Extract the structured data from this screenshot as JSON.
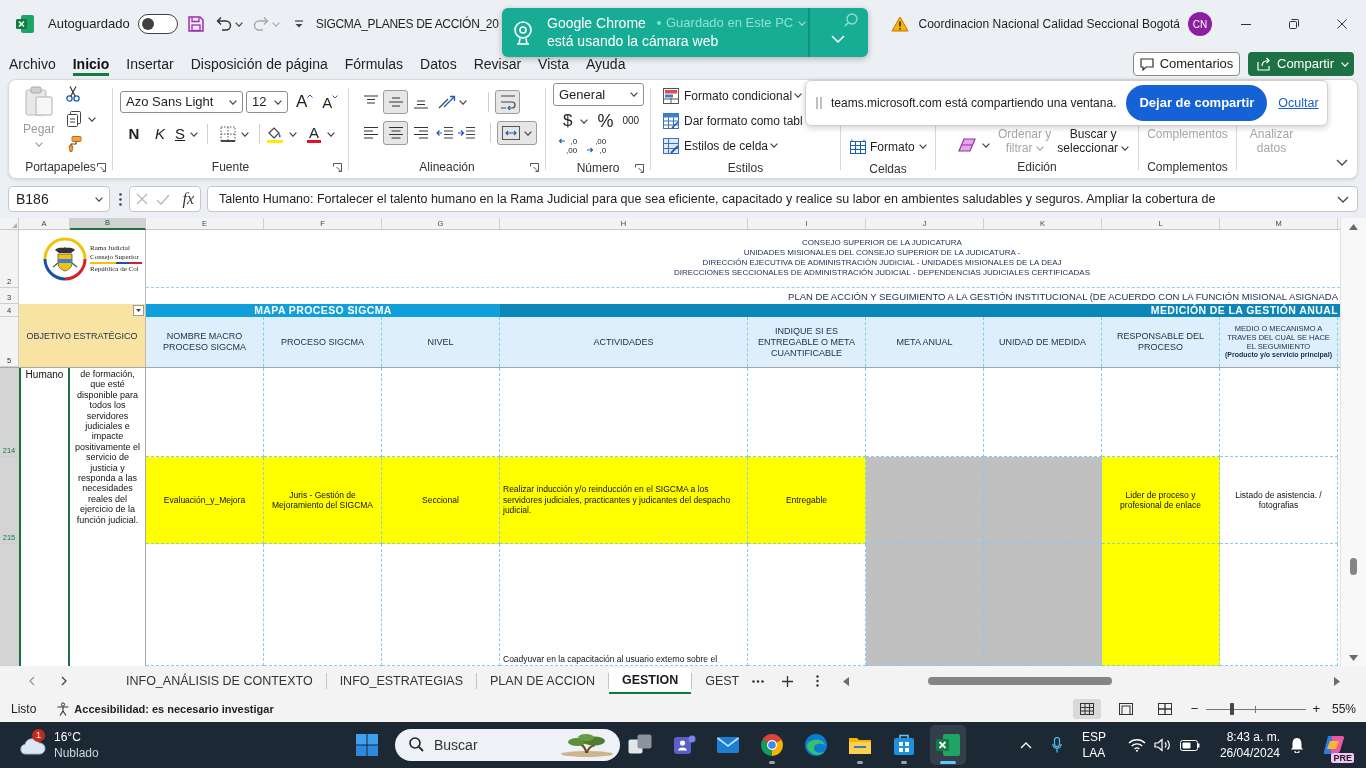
{
  "title_bar": {
    "autosave_label": "Autoguardado",
    "autosave_on": false,
    "file_name": "SIGCMA_PLANES DE ACCIÓN_20",
    "save_status": "Guardado en Este PC",
    "account_name": "Coordinacion Nacional Calidad Seccional Bogotá",
    "avatar_initials": "CN"
  },
  "camera_notification": {
    "app": "Google Chrome",
    "message": "está usando la cámara web"
  },
  "menu_tabs": [
    {
      "label": "Archivo",
      "selected": false
    },
    {
      "label": "Inicio",
      "selected": true
    },
    {
      "label": "Insertar",
      "selected": false
    },
    {
      "label": "Disposición de página",
      "selected": false
    },
    {
      "label": "Fórmulas",
      "selected": false
    },
    {
      "label": "Datos",
      "selected": false
    },
    {
      "label": "Revisar",
      "selected": false
    },
    {
      "label": "Vista",
      "selected": false
    },
    {
      "label": "Ayuda",
      "selected": false
    }
  ],
  "header_buttons": {
    "comments": "Comentarios",
    "share": "Compartir"
  },
  "ribbon": {
    "clipboard": {
      "paste": "Pegar",
      "paste_disabled": true,
      "label": "Portapapeles"
    },
    "font": {
      "font_name": "Azo Sans Light",
      "font_size": "12",
      "grow": "A",
      "shrink": "A",
      "bold": "N",
      "italic": "K",
      "underline": "S",
      "font_color": "A",
      "label": "Fuente"
    },
    "alignment": {
      "vertical": [
        {
          "kind": "top",
          "selected": false
        },
        {
          "kind": "middle",
          "selected": true
        },
        {
          "kind": "bottom",
          "selected": false
        }
      ],
      "horizontal": [
        {
          "kind": "left",
          "selected": false
        },
        {
          "kind": "center",
          "selected": true
        },
        {
          "kind": "right",
          "selected": false
        }
      ],
      "wrap_text": true,
      "merge": true,
      "label": "Alineación"
    },
    "number": {
      "format": "General",
      "currency": "$",
      "percent": "%",
      "thousands": "000",
      "decimals": [
        {
          "kind": "decrease",
          "upper": ",0",
          "lower": ",00"
        },
        {
          "kind": "increase",
          "upper": ",00",
          "lower": ",0"
        }
      ],
      "label": "Número"
    },
    "styles": {
      "items": [
        {
          "kind": "conditional",
          "label": "Formato condicional"
        },
        {
          "kind": "table",
          "label": "Dar formato como tabl"
        },
        {
          "kind": "cell_styles",
          "label": "Estilos de celda"
        }
      ],
      "label": "Estilos"
    },
    "cells": {
      "format": "Formato",
      "label": "Celdas"
    },
    "editing": {
      "buttons": [
        {
          "lines": [
            "Ordenar y",
            "filtrar"
          ],
          "disabled": true
        },
        {
          "lines": [
            "Buscar y",
            "seleccionar"
          ],
          "disabled": false
        }
      ],
      "label": "Edición"
    },
    "addins": {
      "item": "Complementos",
      "item_disabled": true,
      "label": "Complementos"
    },
    "analyze": {
      "lines": [
        "Analizar",
        "datos"
      ],
      "disabled": true
    }
  },
  "share_bar": {
    "message": "teams.microsoft.com está compartiendo una ventana.",
    "stop": "Dejar de compartir",
    "hide": "Ocultar"
  },
  "formula_bar": {
    "name_box": "B186",
    "function_label": "fx",
    "formula": "Talento Humano: Fortalecer el talento humano en la Rama Judicial para que sea eficiente, capacitado y realice su labor en ambientes saludables y seguros. Ampliar la cobertura de"
  },
  "sheet": {
    "columns": [
      {
        "label": "A",
        "selected": false
      },
      {
        "label": "B",
        "selected": true
      },
      {
        "label": "E",
        "selected": false
      },
      {
        "label": "F",
        "selected": false
      },
      {
        "label": "G",
        "selected": false
      },
      {
        "label": "H",
        "selected": false
      },
      {
        "label": "I",
        "selected": false
      },
      {
        "label": "J",
        "selected": false
      },
      {
        "label": "K",
        "selected": false
      },
      {
        "label": "L",
        "selected": false
      },
      {
        "label": "M",
        "selected": false
      }
    ],
    "frozen_rows": [
      {
        "number": "2",
        "selected": false
      },
      {
        "number": "3",
        "selected": false
      },
      {
        "number": "4",
        "selected": false
      },
      {
        "number": "5",
        "selected": false
      }
    ],
    "logo_lines": [
      "Rama Judicial",
      "Consejo Superior",
      "República de Col"
    ],
    "header_lines": [
      "CONSEJO SUPERIOR DE LA JUDICATURA",
      "UNIDADES MISIONALES DEL CONSEJO SUPERIOR DE LA JUDICATURA -",
      "DIRECCIÓN EJECUTIVA DE ADMINISTRACIÓN JUDICIAL - UNIDADES MISIONALES DE LA DEAJ",
      "DIRECCIONES SECCIONALES DE ADMINISTRACIÓN JUDICIAL - DEPENDENCIAS JUDICIALES CERTIFICADAS"
    ],
    "plan_title": "PLAN DE ACCIÓN Y SEGUIMIENTO A LA GESTIÓN INSTITUCIONAL (DE ACUERDO CON LA FUNCIÓN MISIONAL ASIGNADA",
    "bands": [
      {
        "text": "MAPA PROCESO SIGCMA",
        "color": "#0f9fdb"
      },
      {
        "text": "MEDICIÓN DE LA GESTIÓN ANUAL",
        "color": "#0a86b9"
      }
    ],
    "objective_header": "OBJETIVO ESTRATÉGICO",
    "column_headers": [
      {
        "text": "NOMBRE MACRO PROCESO SIGCMA"
      },
      {
        "text": "PROCESO SIGCMA"
      },
      {
        "text": "NIVEL"
      },
      {
        "text": "ACTIVIDADES"
      },
      {
        "text": "INDIQUE SI ES ENTREGABLE O META CUANTIFICABLE"
      },
      {
        "text": "META ANUAL"
      },
      {
        "text": "UNIDAD DE MEDIDA"
      },
      {
        "text": "RESPONSABLE DEL PROCESO"
      },
      {
        "text": "MEDIO O MECANISMO A TRAVES DEL CUAL SE HACE EL SEGUIMIENTO",
        "note": "(Producto y/o servicio principal)"
      }
    ],
    "rows": [
      {
        "number": "214",
        "selected": true,
        "cells": [
          {
            "text": "Humano",
            "color": "#ffffff"
          },
          {
            "text": "de formación, que esté disponible para todos los servidores judiciales e impacte positivamente el servicio de justicia y responda a las necesidades reales del ejercicio de la función judicial.",
            "color": "#ffffff"
          },
          {
            "color": "#ffffff"
          },
          {
            "color": "#ffffff"
          },
          {
            "color": "#ffffff"
          },
          {
            "color": "#ffffff"
          },
          {
            "color": "#ffffff"
          },
          {
            "color": "#ffffff"
          },
          {
            "color": "#ffffff"
          },
          {
            "color": "#ffffff"
          },
          {
            "color": "#ffffff"
          }
        ]
      },
      {
        "number": "215",
        "selected": true,
        "cells": [
          "",
          "",
          {
            "text": "Evaluación_y_Mejora",
            "color": "#ffff00"
          },
          {
            "text": "Juris - Gestión de Mejoramiento del SIGCMA",
            "color": "#ffff00"
          },
          {
            "text": "Seccional",
            "color": "#ffff00"
          },
          {
            "text": "Realizar inducción y/o reinducción en el SIGCMA a los servidores judiciales, practicantes y judicantes del despacho judicial.",
            "color": "#ffff00"
          },
          {
            "text": "Entregable",
            "color": "#ffff00"
          },
          {
            "color": "#c0c0c0"
          },
          {
            "color": "#c0c0c0"
          },
          {
            "text": "Lider de proceso y profesional de enlace",
            "color": "#ffff00"
          },
          {
            "text": "Listado de asistencia. / fotografias",
            "color": "#ffffff"
          }
        ]
      },
      {
        "selected": true,
        "cells": [
          "",
          "",
          {
            "color": "#ffffff"
          },
          {
            "color": "#ffffff"
          },
          {
            "color": "#ffffff"
          },
          {
            "text": "Coadyuvar en la capacitación al usuario externo sobre el",
            "color": "#ffffff"
          },
          {
            "color": "#ffffff"
          },
          {
            "color": "#c0c0c0"
          },
          {
            "color": "#c0c0c0"
          },
          {
            "color": "#ffff00"
          },
          {
            "color": "#ffffff"
          }
        ]
      }
    ]
  },
  "sheet_tabs": [
    {
      "label": "INFO_ANÁLISIS DE CONTEXTO",
      "selected": false
    },
    {
      "label": "INFO_ESTRATEGIAS",
      "selected": false
    },
    {
      "label": "PLAN DE ACCION",
      "selected": false
    },
    {
      "label": "GESTION",
      "selected": true
    },
    {
      "label": "GEST",
      "selected": false
    }
  ],
  "status_bar": {
    "ready": "Listo",
    "accessibility": "Accesibilidad: es necesario investigar",
    "views": [
      {
        "kind": "normal",
        "selected": true
      },
      {
        "kind": "page_layout",
        "selected": false
      },
      {
        "kind": "page_break",
        "selected": false
      }
    ],
    "zoom_out": "−",
    "zoom_slider": {
      "level": 0.26
    },
    "zoom_in": "+",
    "zoom": "55%"
  },
  "taskbar": {
    "weather": {
      "badge": "1",
      "temperature": "16°C",
      "condition": "Nublado"
    },
    "search": {
      "placeholder": "Buscar"
    },
    "apps": [
      {
        "kind": "task_view",
        "running": false,
        "selected": false
      },
      {
        "kind": "teams",
        "running": false,
        "selected": false
      },
      {
        "kind": "mail",
        "running": false,
        "selected": false
      },
      {
        "kind": "chrome",
        "running": true,
        "selected": false
      },
      {
        "kind": "edge",
        "running": false,
        "selected": false
      },
      {
        "kind": "explorer",
        "running": true,
        "selected": false
      },
      {
        "kind": "store",
        "running": true,
        "selected": false
      },
      {
        "kind": "excel",
        "running": true,
        "selected": true
      }
    ],
    "language": "ESP",
    "keyboard": "LAA",
    "time": "8:43 a. m.",
    "date": "26/04/2024",
    "copilot_badge": "PRE"
  }
}
